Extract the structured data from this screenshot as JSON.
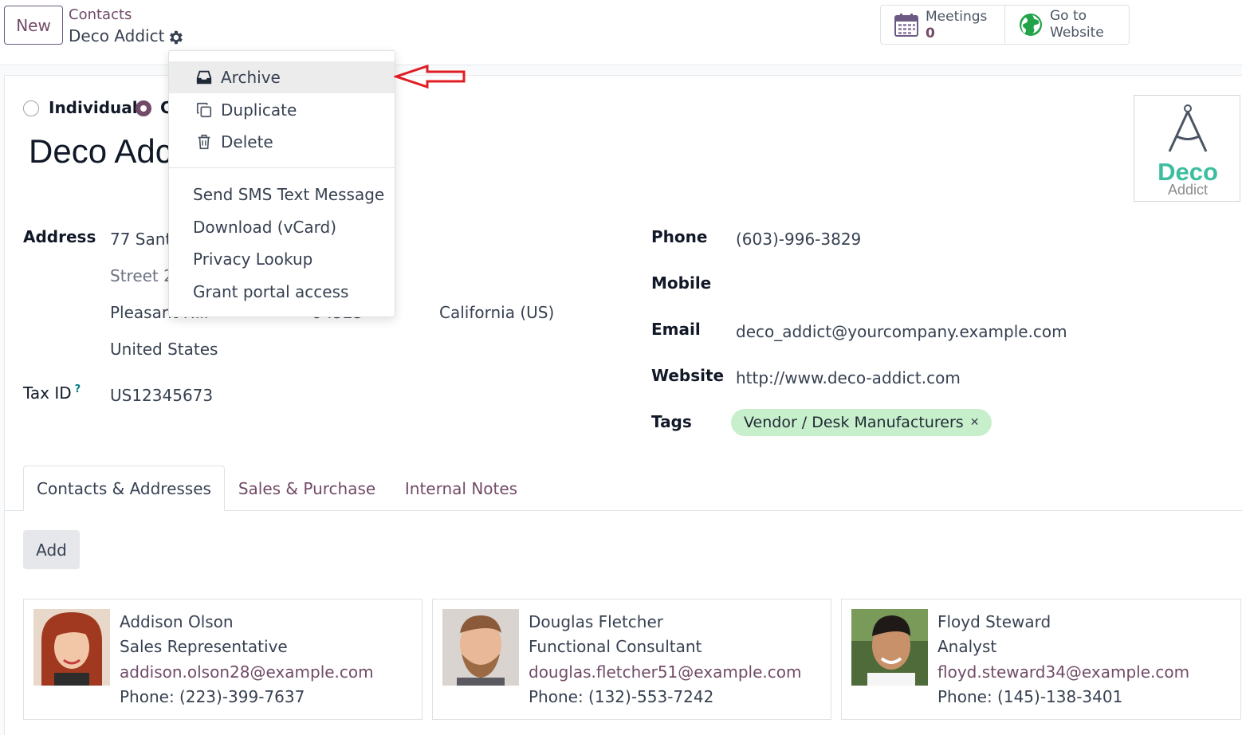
{
  "control_panel": {
    "new_label": "New",
    "breadcrumb_parent": "Contacts",
    "breadcrumb_current": "Deco Addict",
    "smart_buttons": {
      "meetings_label": "Meetings",
      "meetings_count": "0",
      "website_line1": "Go to",
      "website_line2": "Website"
    }
  },
  "gear_menu": {
    "items": [
      {
        "label": "Archive",
        "icon": "archive-icon"
      },
      {
        "label": "Duplicate",
        "icon": "duplicate-icon"
      },
      {
        "label": "Delete",
        "icon": "trash-icon"
      }
    ],
    "actions": [
      {
        "label": "Send SMS Text Message"
      },
      {
        "label": "Download (vCard)"
      },
      {
        "label": "Privacy Lookup"
      },
      {
        "label": "Grant portal access"
      }
    ]
  },
  "form": {
    "company_type": {
      "individual_label": "Individual",
      "company_label_visible": "C",
      "selected": "company"
    },
    "name_visible": "Deco Adc",
    "logo": {
      "line1": "Deco",
      "line2": "Addict",
      "accent": "#3dbd9f"
    },
    "address_label": "Address",
    "street_visible": "77 Santa",
    "street2_placeholder_visible": "Street 2.",
    "city_visible": "Pleasant Hill",
    "zip_visible": "94523",
    "state": "California (US)",
    "country": "United States",
    "tax_id_label": "Tax ID",
    "tax_id_help": "?",
    "tax_id": "US12345673",
    "phone_label": "Phone",
    "phone": "(603)-996-3829",
    "mobile_label": "Mobile",
    "email_label": "Email",
    "email": "deco_addict@yourcompany.example.com",
    "website_label": "Website",
    "website": "http://www.deco-addict.com",
    "tags_label": "Tags",
    "tags": [
      {
        "label": "Vendor / Desk Manufacturers",
        "color": "#c8efcb"
      }
    ]
  },
  "tabs": [
    {
      "label": "Contacts & Addresses",
      "active": true
    },
    {
      "label": "Sales & Purchase",
      "active": false
    },
    {
      "label": "Internal Notes",
      "active": false
    }
  ],
  "contacts": {
    "add_label": "Add",
    "cards": [
      {
        "name": "Addison Olson",
        "job": "Sales Representative",
        "email": "addison.olson28@example.com",
        "phone": "Phone: (223)-399-7637"
      },
      {
        "name": "Douglas Fletcher",
        "job": "Functional Consultant",
        "email": "douglas.fletcher51@example.com",
        "phone": "Phone: (132)-553-7242"
      },
      {
        "name": "Floyd Steward",
        "job": "Analyst",
        "email": "floyd.steward34@example.com",
        "phone": "Phone: (145)-138-3401"
      }
    ]
  },
  "colors": {
    "brand": "#714b67",
    "tag_green": "#c8efcb",
    "annotation_arrow": "#e11d24"
  }
}
